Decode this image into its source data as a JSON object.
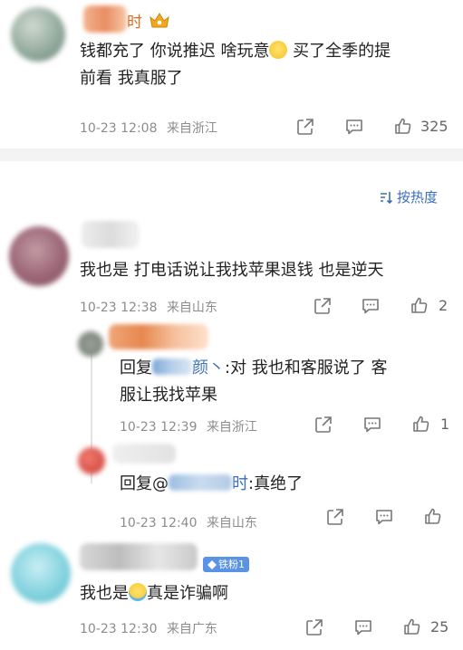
{
  "comments": [
    {
      "id": "c0",
      "name_suffix": "时",
      "text_a": "钱都充了 你说推迟 啥玩意",
      "text_b": " 买了全季的提",
      "text_line2": "前看 我真服了",
      "time": "10-23 12:08",
      "location": "来自浙江",
      "likes": "325"
    },
    {
      "id": "c1",
      "text": "我也是 打电话说让我找苹果退钱 也是逆天",
      "time": "10-23 12:38",
      "location": "来自山东",
      "likes": "2"
    },
    {
      "id": "r1",
      "reply_prefix": "回复",
      "reply_name_visible": "颜丶",
      "reply_rest": ":对 我也和客服说了 客",
      "text_line2": "服让我找苹果",
      "time": "10-23 12:39",
      "location": "来自浙江",
      "likes": "1"
    },
    {
      "id": "r2",
      "reply_prefix": "回复@",
      "reply_name_visible": "时",
      "reply_rest": ":真绝了",
      "time": "10-23 12:40",
      "location": "来自山东"
    },
    {
      "id": "c2",
      "badge": "铁粉1",
      "text_a": "我也是",
      "text_b": "真是诈骗啊",
      "time": "10-23 12:30",
      "location": "来自广东",
      "likes": "25"
    }
  ],
  "sort_label": "按热度",
  "colors": {
    "link": "#3b6fb6",
    "meta": "#8c8c8c",
    "separator": "#f3f3f3",
    "badge": "#5a92e6"
  },
  "icons": [
    "share-icon",
    "comment-icon",
    "like-icon",
    "sort-icon",
    "crown-icon",
    "diamond-icon"
  ]
}
